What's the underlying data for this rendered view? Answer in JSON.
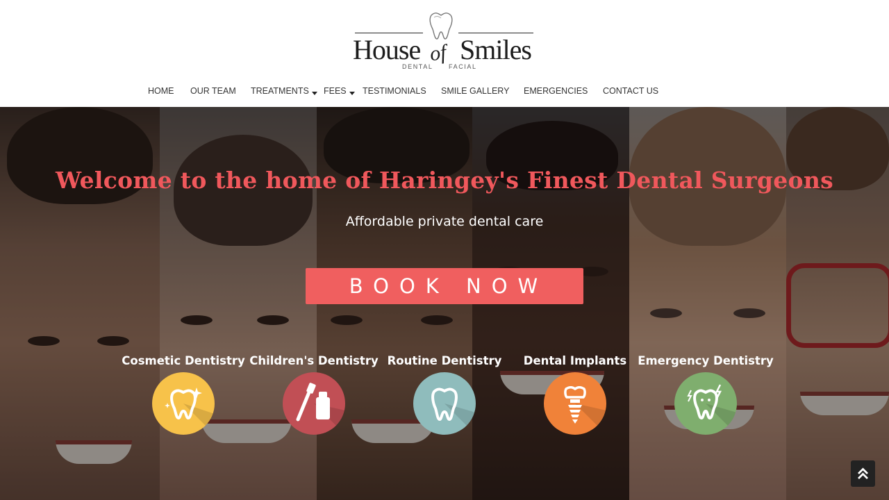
{
  "logo": {
    "word1": "House",
    "word2": "of",
    "word3": "Smiles",
    "sub_left": "DENTAL",
    "sub_right": "FACIAL"
  },
  "nav": [
    {
      "label": "HOME"
    },
    {
      "label": "OUR TEAM"
    },
    {
      "label": "TREATMENTS",
      "dropdown": true
    },
    {
      "label": "FEES",
      "dropdown": true
    },
    {
      "label": "TESTIMONIALS"
    },
    {
      "label": "SMILE GALLERY"
    },
    {
      "label": "EMERGENCIES"
    },
    {
      "label": "CONTACT US"
    }
  ],
  "hero": {
    "headline": "Welcome to the home of Haringey's Finest Dental Surgeons",
    "subheadline": "Affordable private dental care",
    "cta": "BOOK NOW"
  },
  "services": [
    {
      "label": "Cosmetic Dentistry",
      "icon": "sparkling-tooth-icon",
      "color": "#f7c24a"
    },
    {
      "label": "Children's Dentistry",
      "icon": "toothbrush-toothpaste-icon",
      "color": "#c14f55"
    },
    {
      "label": "Routine Dentistry",
      "icon": "tooth-icon",
      "color": "#8fbcbc"
    },
    {
      "label": "Dental Implants",
      "icon": "dental-implant-icon",
      "color": "#f08239"
    },
    {
      "label": "Emergency Dentistry",
      "icon": "emergency-tooth-icon",
      "color": "#7fae6e"
    }
  ],
  "colors": {
    "accent": "#f05f5f",
    "headline": "#f0585c",
    "nav_text": "#333333"
  },
  "icons": {
    "logo": "tooth-logo-icon",
    "dropdown": "caret-down-icon",
    "scroll_top": "double-chevron-up-icon"
  }
}
